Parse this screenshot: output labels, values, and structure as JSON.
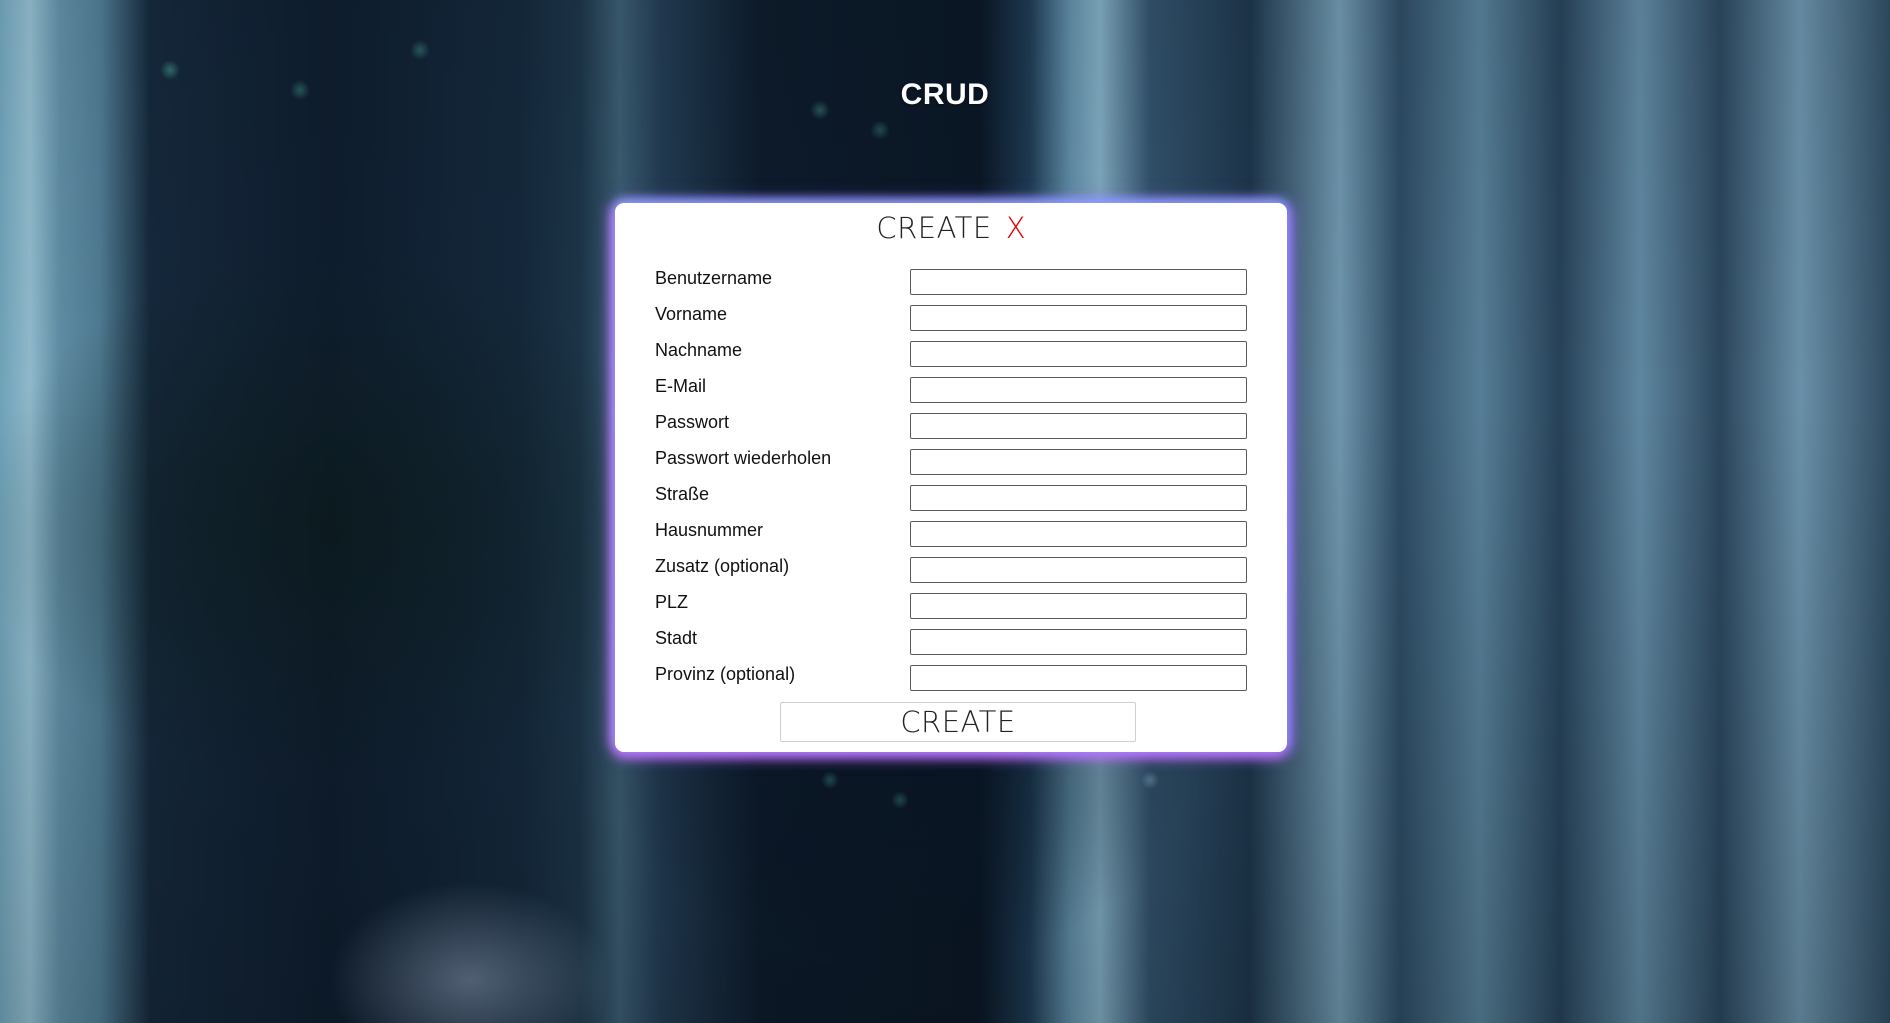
{
  "page": {
    "title": "CRUD"
  },
  "modal": {
    "title": "CREATE",
    "close_label": "X",
    "fields": [
      {
        "label": "Benutzername",
        "value": ""
      },
      {
        "label": "Vorname",
        "value": ""
      },
      {
        "label": "Nachname",
        "value": ""
      },
      {
        "label": "E-Mail",
        "value": ""
      },
      {
        "label": "Passwort",
        "value": ""
      },
      {
        "label": "Passwort wiederholen",
        "value": ""
      },
      {
        "label": "Straße",
        "value": ""
      },
      {
        "label": "Hausnummer",
        "value": ""
      },
      {
        "label": "Zusatz (optional)",
        "value": ""
      },
      {
        "label": "PLZ",
        "value": ""
      },
      {
        "label": "Stadt",
        "value": ""
      },
      {
        "label": "Provinz (optional)",
        "value": ""
      }
    ],
    "submit_label": "CREATE"
  },
  "colors": {
    "close": "#e00000",
    "modal_background": "#ffffff",
    "glow": "#b070ff"
  }
}
